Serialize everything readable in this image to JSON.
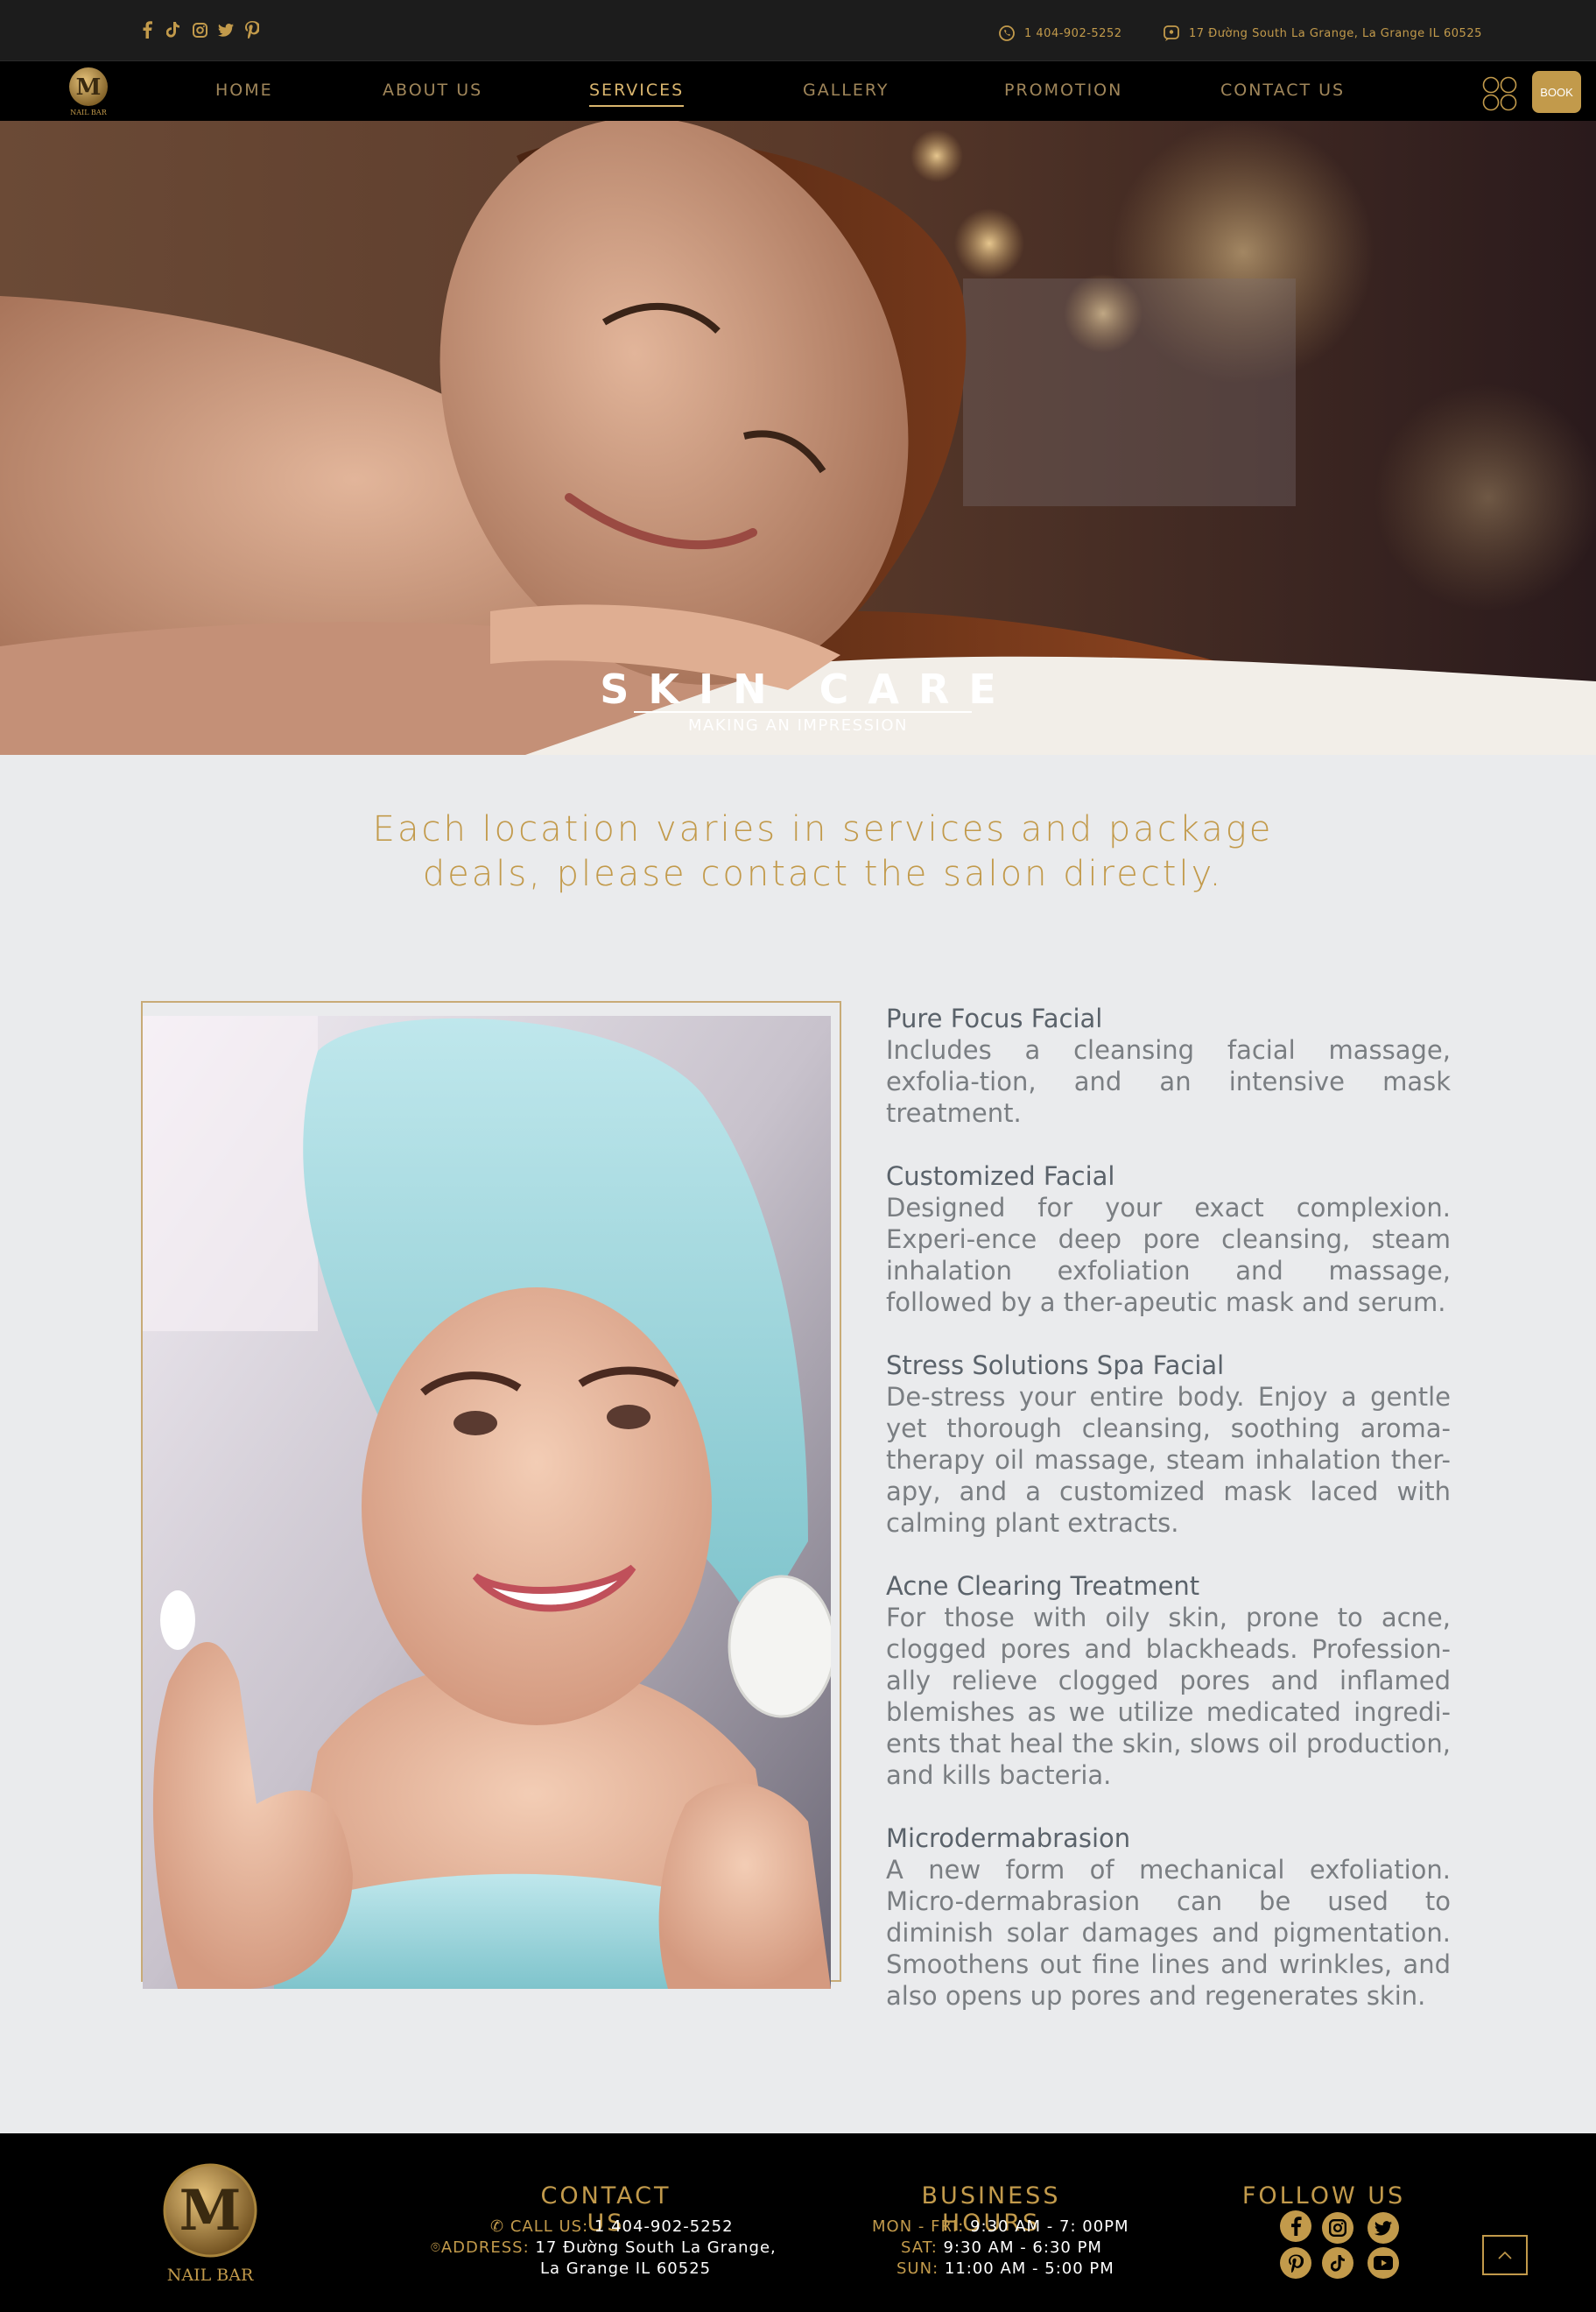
{
  "topbar": {
    "social_icons": [
      "facebook-icon",
      "tiktok-icon",
      "instagram-icon",
      "twitter-icon",
      "pinterest-icon"
    ],
    "phone": "1 404-902-5252",
    "address": "17 Đường South La Grange, La Grange IL 60525"
  },
  "nav": {
    "logo_text": "NAIL BAR",
    "items": [
      {
        "label": "HOME"
      },
      {
        "label": "ABOUT US"
      },
      {
        "label": "SERVICES"
      },
      {
        "label": "GALLERY"
      },
      {
        "label": "PROMOTION"
      },
      {
        "label": "CONTACT US"
      }
    ],
    "active_item": "SERVICES",
    "book_label": "BOOK"
  },
  "hero": {
    "title": "SKIN CARE",
    "subtitle": "MAKING AN IMPRESSION"
  },
  "notice": {
    "line1": "Each location varies in services and package",
    "line2": "deals, please contact the salon directly."
  },
  "services": [
    {
      "name": "Pure Focus Facial",
      "description": "Includes a cleansing facial massage, exfolia-tion, and an intensive mask treatment."
    },
    {
      "name": "Customized Facial",
      "description": "Designed for your exact complexion. Experi-ence deep pore cleansing, steam inhalation exfoliation and massage, followed by a ther-apeutic mask and serum."
    },
    {
      "name": "Stress Solutions Spa Facial",
      "description": "De-stress your entire body. Enjoy a gentle yet thorough cleansing, soothing aroma-therapy oil massage, steam inhalation ther-apy, and a customized mask laced with calming plant extracts."
    },
    {
      "name": "Acne Clearing Treatment",
      "description": "For those with oily skin, prone to acne, clogged pores and blackheads. Profession-ally relieve clogged pores and inflamed blemishes as we utilize medicated ingredi-ents that heal the skin, slows oil production, and kills bacteria."
    },
    {
      "name": "Microdermabrasion",
      "description": "A new form of mechanical exfoliation. Micro-dermabrasion can be used to diminish solar damages and pigmentation. Smoothens out fine lines and wrinkles, and also opens up pores and regenerates skin."
    }
  ],
  "footer": {
    "logo_text": "NAIL BAR",
    "contact": {
      "title": "CONTACT US",
      "call_label": "CALL US:",
      "phone": "1 404-902-5252",
      "address_label": "ADDRESS:",
      "address_line1": "17 Đường South La Grange,",
      "address_line2": "La Grange IL 60525"
    },
    "hours": {
      "title": "BUSINESS HOURS",
      "rows": [
        {
          "day": "MON - FRI:",
          "time": "9:30 AM - 7: 00PM"
        },
        {
          "day": "SAT:",
          "time": "9:30 AM - 6:30 PM"
        },
        {
          "day": "SUN:",
          "time": "11:00 AM - 5:00 PM"
        }
      ]
    },
    "follow": {
      "title": "FOLLOW US",
      "icons": [
        "facebook-icon",
        "instagram-icon",
        "twitter-icon",
        "pinterest-icon",
        "tiktok-icon",
        "youtube-icon"
      ]
    }
  },
  "colors": {
    "gold": "#c29a4b",
    "background": "#eaebed",
    "topbar": "#1c1c1c",
    "nav": "#000000",
    "footer": "#000000"
  }
}
